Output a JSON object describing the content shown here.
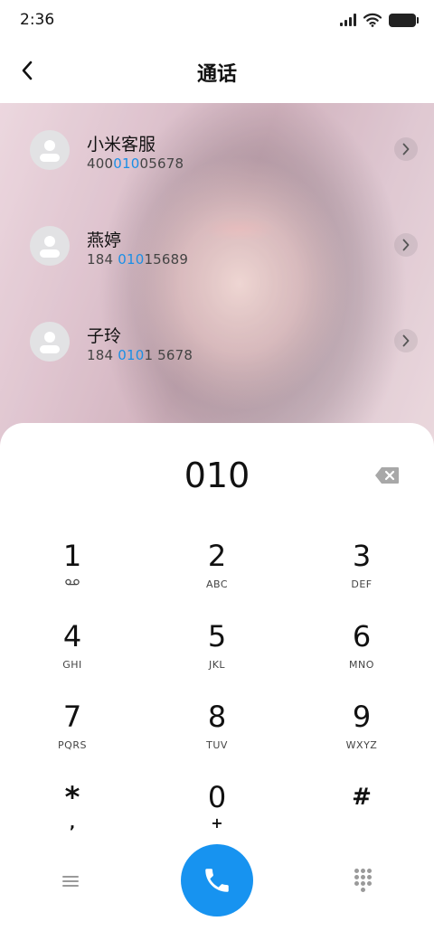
{
  "status_bar": {
    "time": "2:36",
    "icons": [
      "signal-icon",
      "wifi-icon",
      "battery-icon"
    ]
  },
  "header": {
    "title": "通话",
    "back_icon": "chevron-left-icon"
  },
  "contacts": [
    {
      "name": "小米客服",
      "number_before": "400",
      "number_match": "010",
      "number_after": "05678"
    },
    {
      "name": "燕婷",
      "number_before": "184 ",
      "number_match": "010",
      "number_after": "15689"
    },
    {
      "name": "子玲",
      "number_before": "184 ",
      "number_match": "010",
      "number_after": "1 5678"
    }
  ],
  "dialer": {
    "input_value": "010",
    "keys": [
      {
        "digit": "1",
        "letters": ""
      },
      {
        "digit": "2",
        "letters": "ABC"
      },
      {
        "digit": "3",
        "letters": "DEF"
      },
      {
        "digit": "4",
        "letters": "GHI"
      },
      {
        "digit": "5",
        "letters": "JKL"
      },
      {
        "digit": "6",
        "letters": "MNO"
      },
      {
        "digit": "7",
        "letters": "PQRS"
      },
      {
        "digit": "8",
        "letters": "TUV"
      },
      {
        "digit": "9",
        "letters": "WXYZ"
      },
      {
        "digit": "*",
        "letters": ","
      },
      {
        "digit": "0",
        "letters": "+"
      },
      {
        "digit": "#",
        "letters": ""
      }
    ]
  },
  "colors": {
    "accent": "#1793f0",
    "highlight": "#1a8fe6",
    "text": "#111111"
  }
}
